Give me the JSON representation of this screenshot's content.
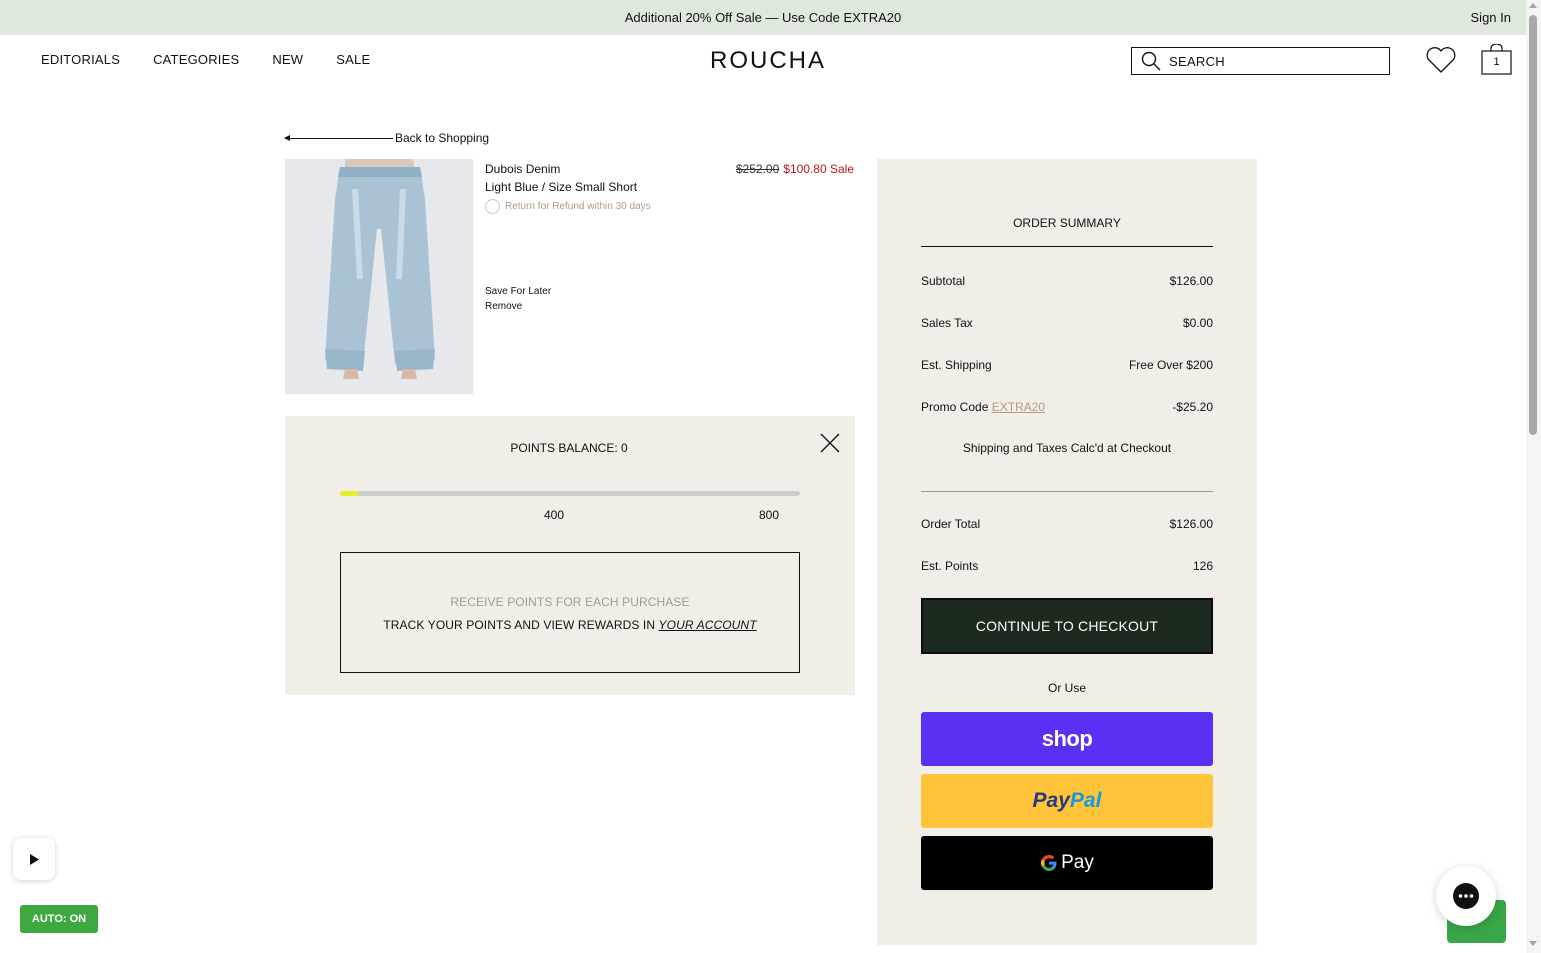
{
  "announcement": {
    "text": "Additional 20% Off Sale — Use Code EXTRA20",
    "sign_in": "Sign In"
  },
  "nav": {
    "items": [
      "EDITORIALS",
      "CATEGORIES",
      "NEW",
      "SALE"
    ]
  },
  "logo": "ROUCHA",
  "search": {
    "placeholder": "SEARCH"
  },
  "cart": {
    "count": "1"
  },
  "back_link": "Back to Shopping",
  "product": {
    "name": "Dubois Denim",
    "variant": "Light Blue / Size Small Short",
    "return_policy": "Return for Refund within 30 days",
    "original_price": "$252.00",
    "sale_price": "$100.80 Sale",
    "save_for_later": "Save For Later",
    "remove": "Remove"
  },
  "points": {
    "balance_label": "POINTS BALANCE: 0",
    "progress_fraction": 0.04,
    "ticks": [
      "400",
      "800"
    ],
    "promo_line1": "RECEIVE POINTS FOR EACH PURCHASE",
    "promo_line2": "TRACK YOUR POINTS AND VIEW REWARDS IN ",
    "account_link": "YOUR ACCOUNT"
  },
  "summary": {
    "title": "ORDER SUMMARY",
    "subtotal_label": "Subtotal",
    "subtotal_value": "$126.00",
    "tax_label": "Sales Tax",
    "tax_value": "$0.00",
    "shipping_label": "Est. Shipping",
    "shipping_value": "Free Over $200",
    "promo_label": "Promo Code ",
    "promo_code": "EXTRA20",
    "promo_value": "-$25.20",
    "note": "Shipping and Taxes Calc'd at Checkout",
    "total_label": "Order Total",
    "total_value": "$126.00",
    "points_label": "Est. Points",
    "points_value": "126",
    "checkout": "CONTINUE TO CHECKOUT",
    "or_use": "Or Use",
    "shop_pay": "shop",
    "paypal_1": "Pay",
    "paypal_2": "Pal",
    "gpay": "Pay"
  },
  "widgets": {
    "auto": "AUTO: ON"
  },
  "colors": {
    "announce_bg": "#dfe8dd",
    "panel_bg": "#f1eee8",
    "sale_red": "#c4141a",
    "checkout_bg": "#1d2b1e",
    "shop_purple": "#5a31f4",
    "paypal_yellow": "#ffc439",
    "progress_fill": "#e5f02a"
  }
}
